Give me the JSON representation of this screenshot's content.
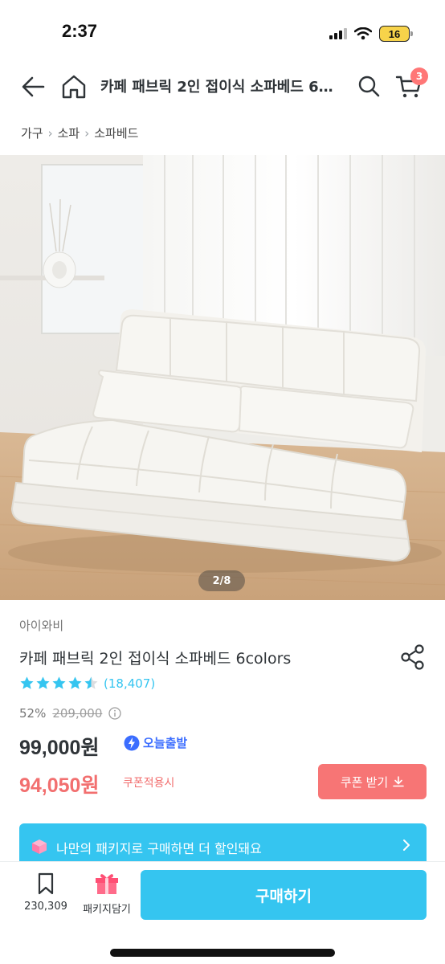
{
  "status_bar": {
    "time": "2:37",
    "battery": "16"
  },
  "header": {
    "title": "카페 패브릭 2인 접이식 소파베드 6colors",
    "cart_count": "3"
  },
  "breadcrumb": [
    "가구",
    "소파",
    "소파베드"
  ],
  "image": {
    "counter": "2/8"
  },
  "product": {
    "brand": "아이와비",
    "name": "카페 패브릭 2인 접이식 소파베드 6colors",
    "rating": 4.5,
    "review_count": "(18,407)",
    "discount_rate": "52%",
    "original_price": "209,000",
    "sale_price": "99,000원",
    "today_badge": "오늘출발",
    "coupon_price": "94,050원",
    "coupon_note": "쿠폰적용시",
    "coupon_button": "쿠폰 받기"
  },
  "package_banner": {
    "text": "나만의 패키지로 구매하면 더 할인돼요"
  },
  "bottom_bar": {
    "bookmark_count": "230,309",
    "package_label": "패키지담기",
    "buy_label": "구매하기"
  },
  "colors": {
    "accent": "#35c5f0",
    "coupon_red": "#f26f6f",
    "star_blue": "#35c5f0",
    "today_blue": "#3b6dff"
  }
}
